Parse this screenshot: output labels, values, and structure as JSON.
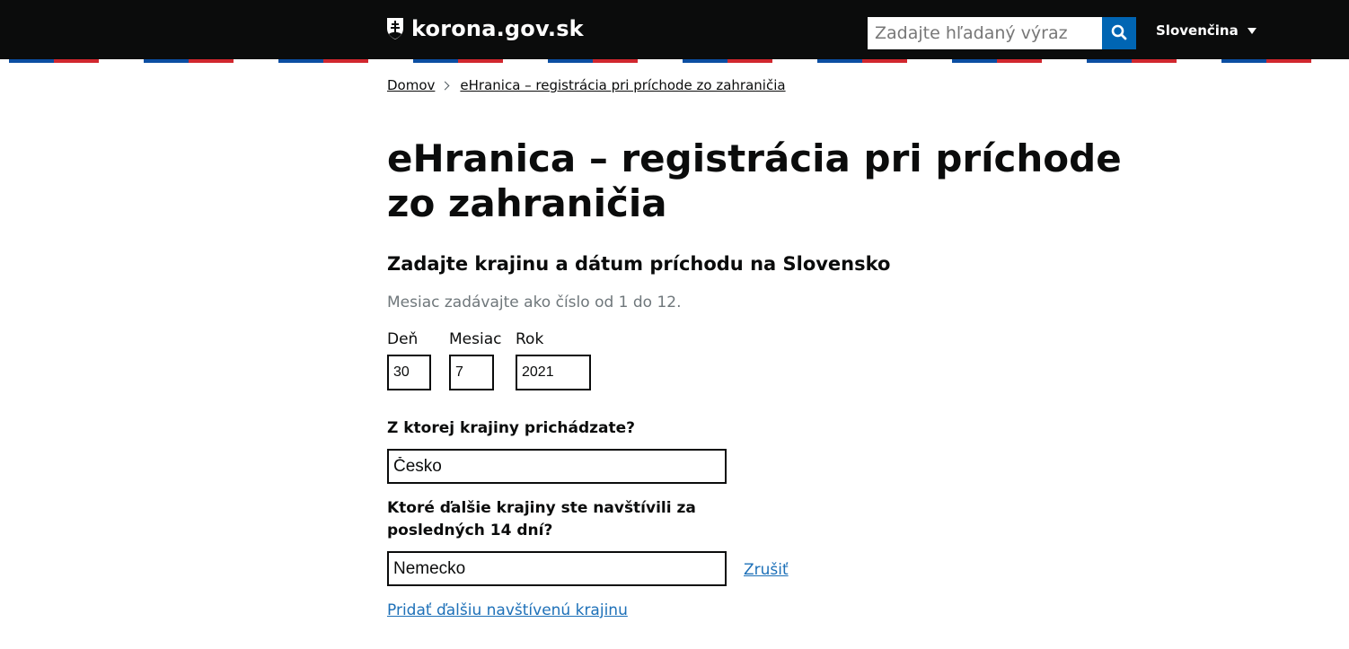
{
  "header": {
    "site_name": "korona.gov.sk",
    "search_placeholder": "Zadajte hľadaný výraz",
    "language": "Slovenčina"
  },
  "breadcrumb": {
    "home": "Domov",
    "current": "eHranica – registrácia pri príchode zo zahraničia"
  },
  "page": {
    "title": "eHranica – registrácia pri príchode zo zahraničia",
    "section_title": "Zadajte krajinu a dátum príchodu na Slovensko",
    "hint": "Mesiac zadávajte ako číslo od 1 do 12."
  },
  "date": {
    "day_label": "Deň",
    "day_value": "30",
    "month_label": "Mesiac",
    "month_value": "7",
    "year_label": "Rok",
    "year_value": "2021"
  },
  "origin": {
    "label": "Z ktorej krajiny prichádzate?",
    "value": "Česko"
  },
  "visited": {
    "label_line1": "Ktoré ďalšie krajiny ste navštívili za",
    "label_line2": "posledných 14 dní?",
    "value": "Nemecko",
    "cancel_label": "Zrušiť",
    "add_label": "Pridať ďalšiu navštívenú krajinu"
  },
  "colors": {
    "header_bg": "#0b0c0c",
    "search_button": "#0065b3",
    "link": "#1d70b8",
    "flag_blue": "#0b4ea2",
    "flag_red": "#d1272e"
  }
}
